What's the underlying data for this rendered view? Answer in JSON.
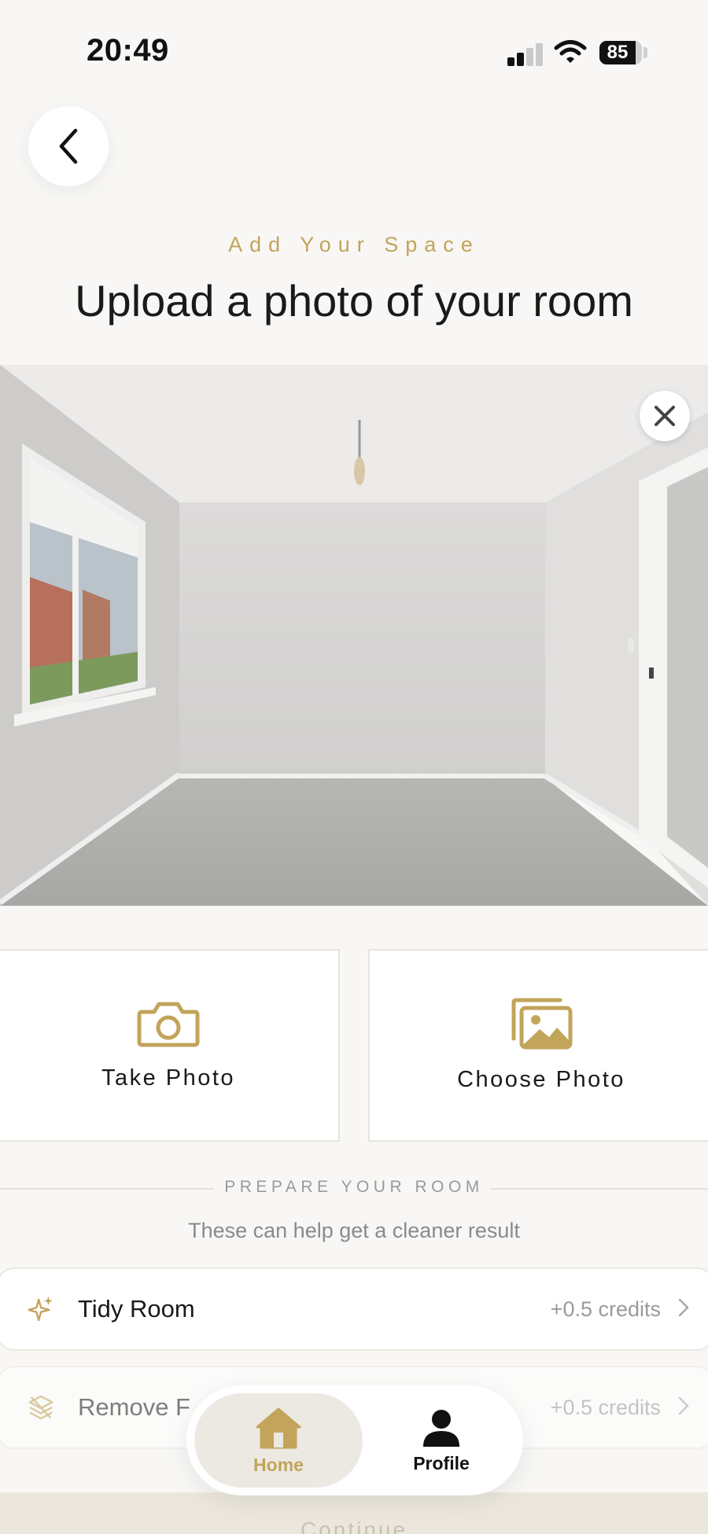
{
  "status_bar": {
    "time": "20:49",
    "battery_percent": "85",
    "signal_bars_active": 2,
    "signal_bars_total": 4
  },
  "header": {
    "back_icon": "chevron-left-icon",
    "eyebrow": "Add Your Space",
    "title": "Upload a photo of your room"
  },
  "photo": {
    "remove_icon": "close-icon"
  },
  "actions": {
    "take_photo": {
      "label": "Take Photo",
      "icon": "camera-icon"
    },
    "choose_photo": {
      "label": "Choose Photo",
      "icon": "gallery-icon"
    }
  },
  "prepare": {
    "section_label": "PREPARE YOUR ROOM",
    "subtitle": "These can help get a cleaner result",
    "items": [
      {
        "label": "Tidy Room",
        "credits": "+0.5 credits",
        "icon": "sparkle-icon"
      },
      {
        "label": "Remove F",
        "credits": "+0.5 credits",
        "icon": "layers-icon"
      }
    ]
  },
  "bottom_strip": {
    "text": "Continue"
  },
  "tab_bar": {
    "tabs": [
      {
        "label": "Home",
        "icon": "home-icon",
        "active": true
      },
      {
        "label": "Profile",
        "icon": "person-icon",
        "active": false
      }
    ]
  },
  "colors": {
    "accent": "#c2a45a",
    "background": "#f8f7f5",
    "text": "#1a1a1a",
    "muted": "#9a9a9a"
  }
}
